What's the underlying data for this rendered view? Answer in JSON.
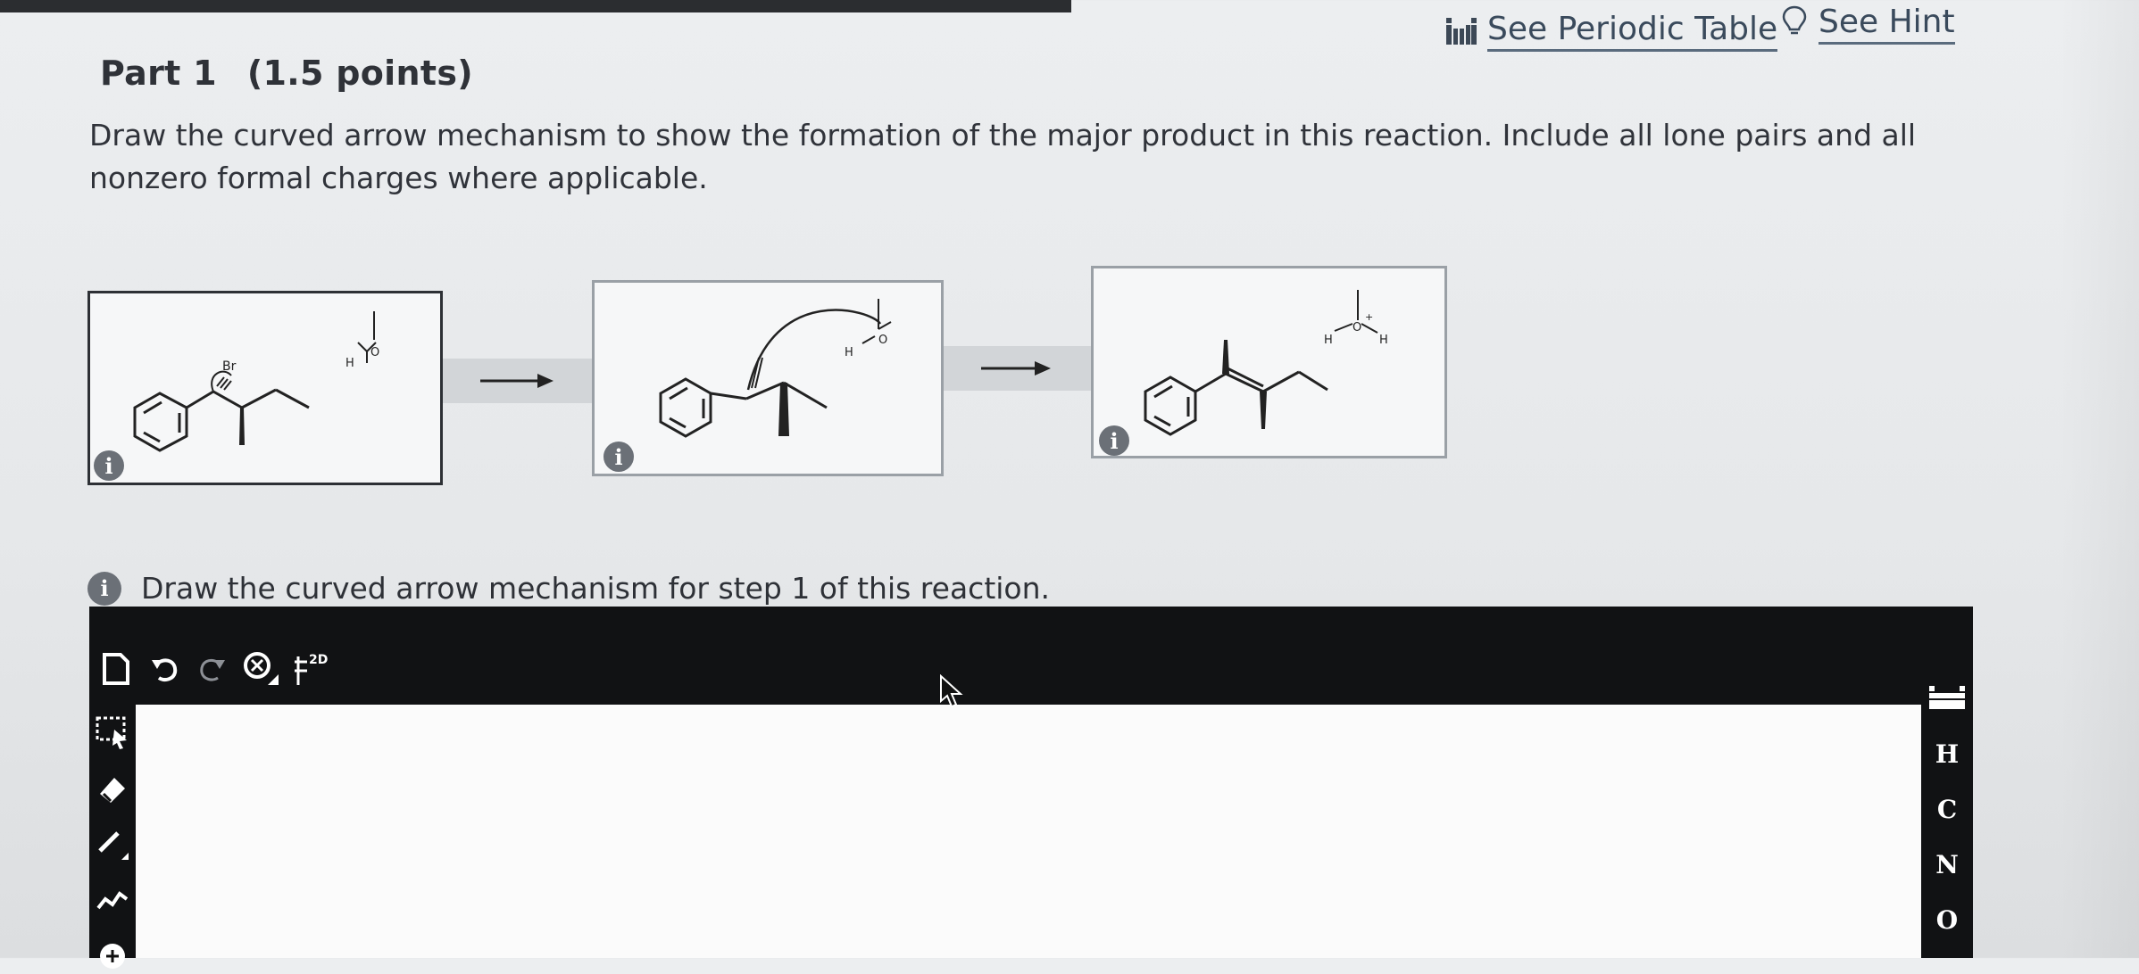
{
  "header": {
    "part_label": "Part 1",
    "points_label": "(1.5 points)",
    "periodic_table_label": "See Periodic Table",
    "hint_label": "See Hint"
  },
  "question": {
    "text": "Draw the curved arrow mechanism to show the formation of the major product in this reaction. Include all lone pairs and all nonzero formal charges where applicable."
  },
  "reaction": {
    "steps": [
      {
        "atoms": [
          "Br",
          "H",
          "O"
        ]
      },
      {
        "atoms": [
          "H",
          "O"
        ]
      },
      {
        "atoms": [
          "H",
          "O",
          "H"
        ],
        "charge": "+"
      }
    ],
    "info_badge_text": "i"
  },
  "step": {
    "badge_text": "i",
    "text": "Draw the curved arrow mechanism for step 1 of this reaction."
  },
  "editor": {
    "toolbar": {
      "icons": [
        "new-document-icon",
        "undo-icon",
        "redo-icon",
        "zoom-clear-icon",
        "2d-clean-icon"
      ],
      "clean_label": "2D"
    },
    "left_tools": [
      "select-lasso-icon",
      "eraser-icon",
      "bond-single-icon",
      "chain-icon",
      "charge-plus-icon"
    ],
    "elements": {
      "periodic_icon": "periodic-table-icon",
      "items": [
        "H",
        "C",
        "N",
        "O"
      ]
    }
  },
  "colors": {
    "background": "#e8eaec",
    "editor_frame": "#111214",
    "link": "#3a4a5c"
  }
}
